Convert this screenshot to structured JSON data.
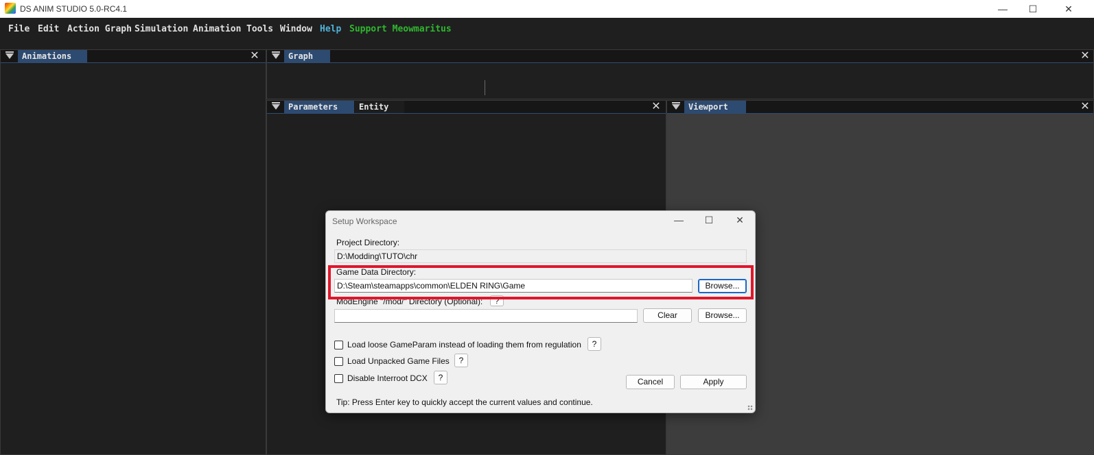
{
  "window": {
    "title": "DS ANIM STUDIO 5.0-RC4.1",
    "minimize": "—",
    "maximize": "☐",
    "close": "✕"
  },
  "menu": [
    "File",
    "Edit",
    "Action Graph",
    "Simulation",
    "Animation",
    "Tools",
    "Window",
    "Help",
    "Support Meowmaritus"
  ],
  "menu_colors": {
    "default": "#e0e0e0",
    "help": "#4fb3d9",
    "support": "#2fb82f"
  },
  "panels": {
    "animations": {
      "tab": "Animations",
      "close": "✕"
    },
    "graph": {
      "tab": "Graph",
      "close": "✕"
    },
    "parameters": {
      "tab1": "Parameters",
      "tab2": "Entity",
      "close": "✕"
    },
    "viewport": {
      "tab": "Viewport",
      "close": "✕"
    }
  },
  "dialog": {
    "title": "Setup Workspace",
    "minimize": "—",
    "maximize": "☐",
    "close": "✕",
    "project_dir_label": "Project Directory:",
    "project_dir_value": "D:\\Modding\\TUTO\\chr",
    "game_dir_label": "Game Data Directory:",
    "game_dir_value": "D:\\Steam\\steamapps\\common\\ELDEN RING\\Game",
    "browse": "Browse...",
    "modengine_label": "ModEngine \"/mod/\" Directory (Optional):",
    "modengine_value": "",
    "clear": "Clear",
    "help_glyph": "?",
    "options": [
      {
        "label": "Load loose GameParam instead of loading them from regulation",
        "checked": false
      },
      {
        "label": "Load Unpacked Game Files",
        "checked": false
      },
      {
        "label": "Disable Interroot DCX",
        "checked": false
      }
    ],
    "cancel": "Cancel",
    "apply": "Apply",
    "tip": "Tip: Press Enter key to quickly accept the current values and continue."
  },
  "highlight_color": "#e0162b"
}
